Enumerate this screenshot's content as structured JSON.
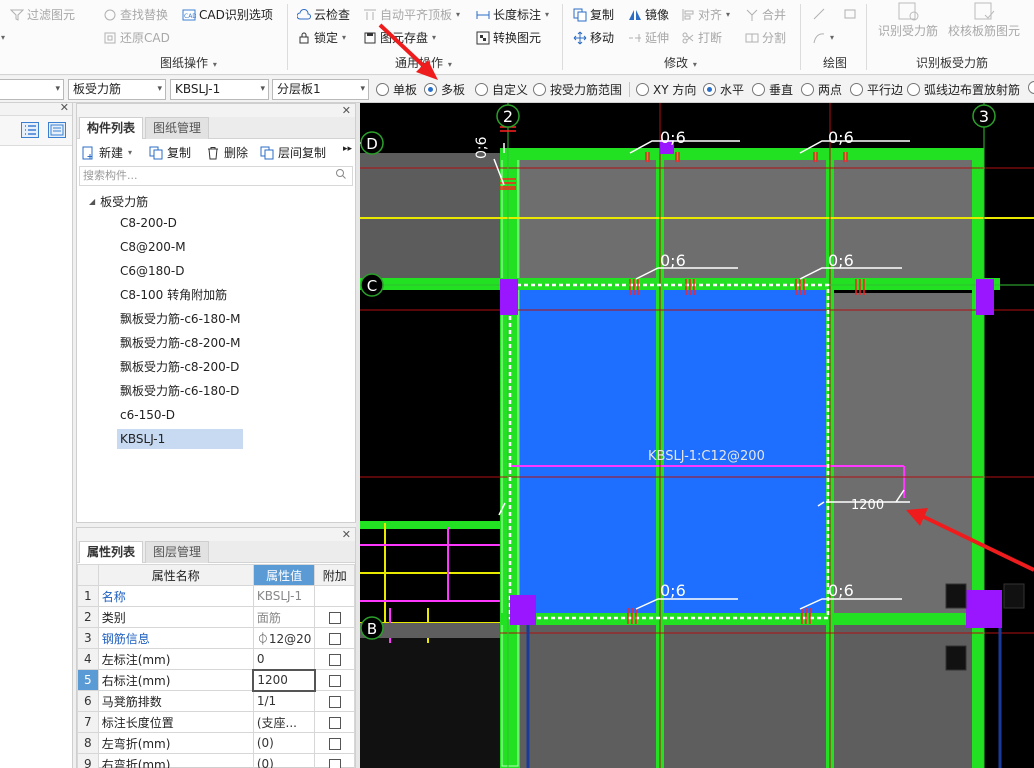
{
  "ribbon": {
    "col1": {
      "filter": "过滤图元",
      "restore": "还原CAD"
    },
    "col2": {
      "find": "查找替换",
      "cad_options": "CAD识别选项",
      "restore_cad": "还原CAD"
    },
    "drawing_ops_title": "图纸操作",
    "col3": {
      "cloud_check": "云检查",
      "auto_align": "自动平齐顶板",
      "length_mark": "长度标注",
      "lock": "锁定",
      "save_graph": "图元存盘",
      "convert": "转换图元"
    },
    "general_ops_title": "通用操作",
    "modify": {
      "copy": "复制",
      "mirror": "镜像",
      "align": "对齐",
      "merge": "合并",
      "move": "移动",
      "extend": "延伸",
      "break": "打断",
      "split": "分割"
    },
    "modify_title": "修改",
    "draw_title": "绘图",
    "identify": {
      "recognize": "识别受力筋",
      "check": "校核板筋图元"
    },
    "identify_title": "识别板受力筋"
  },
  "propbar": {
    "dd1": "板受力筋",
    "dd2": "KBSLJ-1",
    "dd3": "分层板1",
    "radios": [
      {
        "label": "单板",
        "on": false
      },
      {
        "label": "多板",
        "on": true
      },
      {
        "label": "自定义",
        "on": false
      },
      {
        "label": "按受力筋范围",
        "on": false
      },
      {
        "label": "XY 方向",
        "on": false
      },
      {
        "label": "水平",
        "on": true
      },
      {
        "label": "垂直",
        "on": false
      },
      {
        "label": "两点",
        "on": false
      },
      {
        "label": "平行边",
        "on": false
      },
      {
        "label": "弧线边布置放射筋",
        "on": false
      }
    ]
  },
  "component_panel": {
    "tabs": [
      "构件列表",
      "图纸管理"
    ],
    "tools": {
      "new": "新建",
      "copy": "复制",
      "delete": "删除",
      "floor_copy": "层间复制"
    },
    "search_placeholder": "搜索构件...",
    "tree_root": "板受力筋",
    "items": [
      "C8-200-D",
      "C8@200-M",
      "C6@180-D",
      "C8-100 转角附加筋",
      "飘板受力筋-c6-180-M",
      "飘板受力筋-c8-200-M",
      "飘板受力筋-c8-200-D",
      "飘板受力筋-c6-180-D",
      "c6-150-D",
      "KBSLJ-1"
    ],
    "selected_index": 9
  },
  "property_panel": {
    "tabs": [
      "属性列表",
      "图层管理"
    ],
    "headers": {
      "name": "属性名称",
      "value": "属性值",
      "extra": "附加"
    },
    "rows": [
      {
        "n": "1",
        "name": "名称",
        "value": "KBSLJ-1",
        "link": true,
        "gray": true,
        "check": false
      },
      {
        "n": "2",
        "name": "类别",
        "value": "面筋",
        "link": false,
        "gray": true,
        "check": true
      },
      {
        "n": "3",
        "name": "钢筋信息",
        "value": "⏀12@20",
        "link": true,
        "gray": false,
        "check": true
      },
      {
        "n": "4",
        "name": "左标注(mm)",
        "value": "0",
        "link": false,
        "gray": false,
        "check": true
      },
      {
        "n": "5",
        "name": "右标注(mm)",
        "value": "1200",
        "link": false,
        "gray": false,
        "check": true,
        "current": true
      },
      {
        "n": "6",
        "name": "马凳筋排数",
        "value": "1/1",
        "link": false,
        "gray": false,
        "check": true
      },
      {
        "n": "7",
        "name": "标注长度位置",
        "value": "(支座...",
        "link": false,
        "gray": false,
        "check": true
      },
      {
        "n": "8",
        "name": "左弯折(mm)",
        "value": "(0)",
        "link": false,
        "gray": false,
        "check": true
      },
      {
        "n": "9",
        "name": "右弯折(mm)",
        "value": "(0)",
        "link": false,
        "gray": false,
        "check": true
      }
    ]
  },
  "canvas": {
    "axis_labels": {
      "a2": "2",
      "a3": "3",
      "d": "D",
      "c": "C",
      "b": "B"
    },
    "dim_labels": [
      "0;6",
      "0;6",
      "0;6",
      "0;6",
      "0;6",
      "0;6"
    ],
    "vertical_label": "0;6",
    "rebar_label": "KBSLJ-1:C12@200",
    "length_label": "1200",
    "colors": {
      "slab_blue": "#1e6fff",
      "beam_green": "#22e022",
      "slab_gray": "#6f6f6f",
      "column_purple": "#9a16ff"
    }
  }
}
